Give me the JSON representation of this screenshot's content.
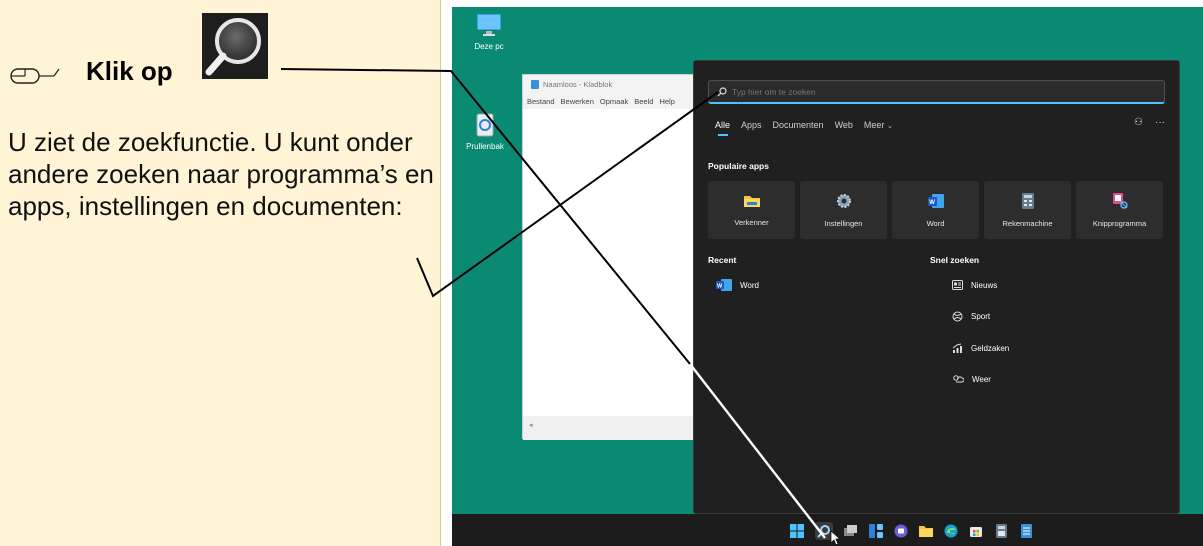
{
  "instructions": {
    "step_action": "Klik op",
    "description": "U ziet de zoekfunctie. U kunt onder andere zoeken naar programma’s en apps, instellingen en documenten:"
  },
  "desktop": {
    "background_color": "#0b8a73",
    "icons": [
      {
        "label": "Deze pc",
        "icon": "monitor-icon"
      },
      {
        "label": "Prullenbak",
        "icon": "recycle-bin-icon"
      }
    ]
  },
  "notepad": {
    "title": "Naamloos - Kladblok",
    "menu": [
      "Bestand",
      "Bewerken",
      "Opmaak",
      "Beeld",
      "Help"
    ]
  },
  "search_panel": {
    "placeholder": "Typ hier om te zoeken",
    "tabs": [
      "Alle",
      "Apps",
      "Documenten",
      "Web",
      "Meer"
    ],
    "active_tab": "Alle",
    "popular_title": "Populaire apps",
    "popular_apps": [
      {
        "label": "Verkenner",
        "icon": "folder-icon"
      },
      {
        "label": "Instellingen",
        "icon": "gear-icon"
      },
      {
        "label": "Word",
        "icon": "word-icon"
      },
      {
        "label": "Rekenmachine",
        "icon": "calculator-icon"
      },
      {
        "label": "Knipprogramma",
        "icon": "snipping-tool-icon"
      }
    ],
    "recent_title": "Recent",
    "recent_items": [
      {
        "label": "Word",
        "icon": "word-icon"
      }
    ],
    "quick_title": "Snel zoeken",
    "quick_items": [
      {
        "label": "Nieuws",
        "icon": "news-icon"
      },
      {
        "label": "Sport",
        "icon": "sport-icon"
      },
      {
        "label": "Geldzaken",
        "icon": "finance-icon"
      },
      {
        "label": "Weer",
        "icon": "weather-icon"
      }
    ],
    "accent_color": "#4cc2ff"
  },
  "taskbar": {
    "icons": [
      "windows-start-icon",
      "search-icon",
      "task-view-icon",
      "widgets-icon",
      "chat-icon",
      "file-explorer-icon",
      "edge-icon",
      "store-icon",
      "calculator-icon",
      "notepad-icon"
    ]
  }
}
